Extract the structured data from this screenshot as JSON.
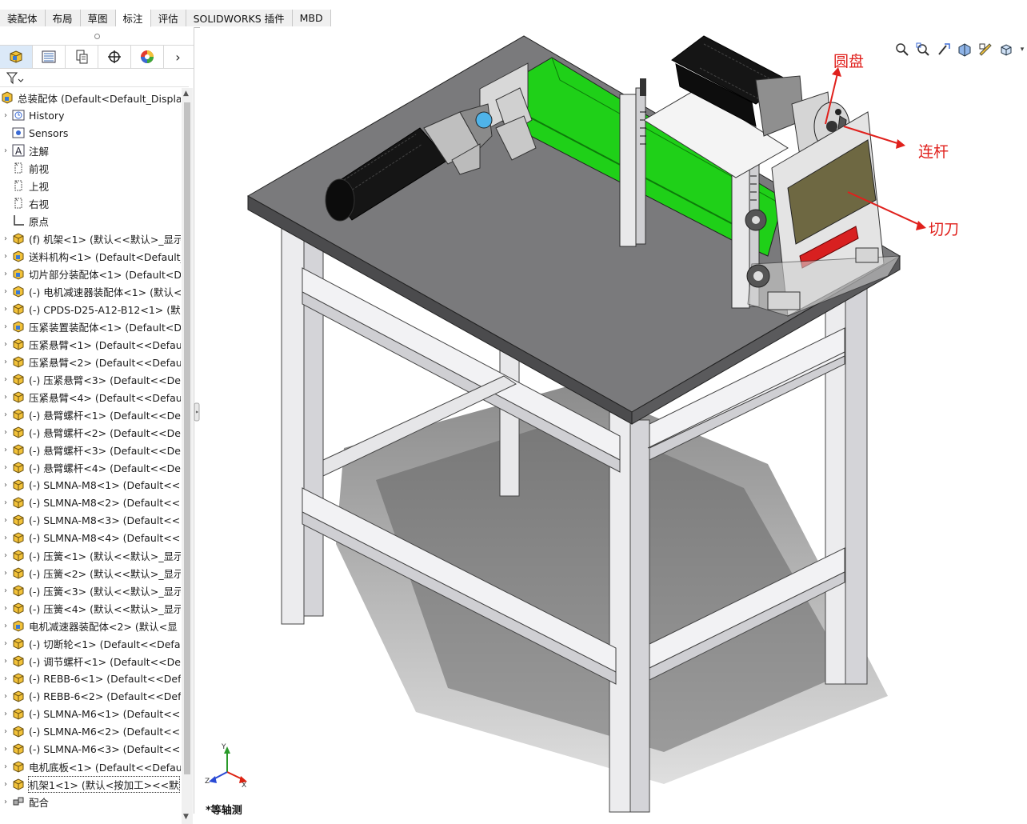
{
  "tabs": [
    "装配体",
    "布局",
    "草图",
    "标注",
    "评估",
    "SOLIDWORKS 插件",
    "MBD"
  ],
  "active_tab": "标注",
  "left_panel_icons": [
    "feature-manager-icon",
    "property-manager-icon",
    "configuration-manager-icon",
    "dim-xpert-icon",
    "display-manager-icon"
  ],
  "tree": {
    "root": "总装配体  (Default<Default_Display",
    "items": [
      {
        "label": "History",
        "icon": "history-icon",
        "expand": true
      },
      {
        "label": "Sensors",
        "icon": "sensors-icon",
        "expand": false
      },
      {
        "label": "注解",
        "icon": "annotations-icon",
        "expand": true
      },
      {
        "label": "前视",
        "icon": "plane-icon",
        "expand": false
      },
      {
        "label": "上视",
        "icon": "plane-icon",
        "expand": false
      },
      {
        "label": "右视",
        "icon": "plane-icon",
        "expand": false
      },
      {
        "label": "原点",
        "icon": "origin-icon",
        "expand": false
      },
      {
        "label": "(f) 机架<1> (默认<<默认>_显示",
        "icon": "part-icon",
        "expand": true
      },
      {
        "label": "送料机构<1> (Default<Default_",
        "icon": "subassembly-icon",
        "expand": true
      },
      {
        "label": "切片部分装配体<1> (Default<D",
        "icon": "subassembly-icon",
        "expand": true
      },
      {
        "label": "(-) 电机减速器装配体<1> (默认<",
        "icon": "subassembly-icon",
        "expand": true
      },
      {
        "label": "(-) CPDS-D25-A12-B12<1> (默",
        "icon": "part-icon",
        "expand": true
      },
      {
        "label": "压紧装置装配体<1> (Default<D",
        "icon": "subassembly-icon",
        "expand": true
      },
      {
        "label": "压紧悬臂<1> (Default<<Defau",
        "icon": "part-icon",
        "expand": true
      },
      {
        "label": "压紧悬臂<2> (Default<<Defau",
        "icon": "part-icon",
        "expand": true
      },
      {
        "label": "(-) 压紧悬臂<3> (Default<<De",
        "icon": "part-icon",
        "expand": true
      },
      {
        "label": "压紧悬臂<4> (Default<<Defau",
        "icon": "part-icon",
        "expand": true
      },
      {
        "label": "(-) 悬臂螺杆<1> (Default<<De",
        "icon": "part-icon",
        "expand": true
      },
      {
        "label": "(-) 悬臂螺杆<2> (Default<<De",
        "icon": "part-icon",
        "expand": true
      },
      {
        "label": "(-) 悬臂螺杆<3> (Default<<De",
        "icon": "part-icon",
        "expand": true
      },
      {
        "label": "(-) 悬臂螺杆<4> (Default<<De",
        "icon": "part-icon",
        "expand": true
      },
      {
        "label": "(-) SLMNA-M8<1> (Default<<",
        "icon": "part-icon",
        "expand": true
      },
      {
        "label": "(-) SLMNA-M8<2> (Default<<",
        "icon": "part-icon",
        "expand": true
      },
      {
        "label": "(-) SLMNA-M8<3> (Default<<",
        "icon": "part-icon",
        "expand": true
      },
      {
        "label": "(-) SLMNA-M8<4> (Default<<",
        "icon": "part-icon",
        "expand": true
      },
      {
        "label": "(-) 压簧<1> (默认<<默认>_显示",
        "icon": "part-icon",
        "expand": true
      },
      {
        "label": "(-) 压簧<2> (默认<<默认>_显示",
        "icon": "part-icon",
        "expand": true
      },
      {
        "label": "(-) 压簧<3> (默认<<默认>_显示",
        "icon": "part-icon",
        "expand": true
      },
      {
        "label": "(-) 压簧<4> (默认<<默认>_显示",
        "icon": "part-icon",
        "expand": true
      },
      {
        "label": "电机减速器装配体<2> (默认<显",
        "icon": "subassembly-icon",
        "expand": true
      },
      {
        "label": "(-) 切断轮<1> (Default<<Defa",
        "icon": "part-icon",
        "expand": true
      },
      {
        "label": "(-) 调节螺杆<1> (Default<<De",
        "icon": "part-icon",
        "expand": true
      },
      {
        "label": "(-) REBB-6<1> (Default<<Defa",
        "icon": "part-icon",
        "expand": true
      },
      {
        "label": "(-) REBB-6<2> (Default<<Defa",
        "icon": "part-icon",
        "expand": true
      },
      {
        "label": "(-) SLMNA-M6<1> (Default<<",
        "icon": "part-icon",
        "expand": true
      },
      {
        "label": "(-) SLMNA-M6<2> (Default<<",
        "icon": "part-icon",
        "expand": true
      },
      {
        "label": "(-) SLMNA-M6<3> (Default<<",
        "icon": "part-icon",
        "expand": true
      },
      {
        "label": "电机底板<1> (Default<<Defau",
        "icon": "part-icon",
        "expand": true
      },
      {
        "label": "机架1<1> (默认<按加工><<默",
        "icon": "part-icon",
        "expand": true,
        "selected": true
      },
      {
        "label": "配合",
        "icon": "mates-icon",
        "expand": true
      }
    ]
  },
  "callouts": {
    "disc": "圆盘",
    "link": "连杆",
    "cutter": "切刀"
  },
  "view_name": "*等轴测",
  "colors": {
    "accent": "#dbe9f8",
    "callout": "#e0201c",
    "belt": "#1fd018",
    "table": "#7a7a7c"
  }
}
